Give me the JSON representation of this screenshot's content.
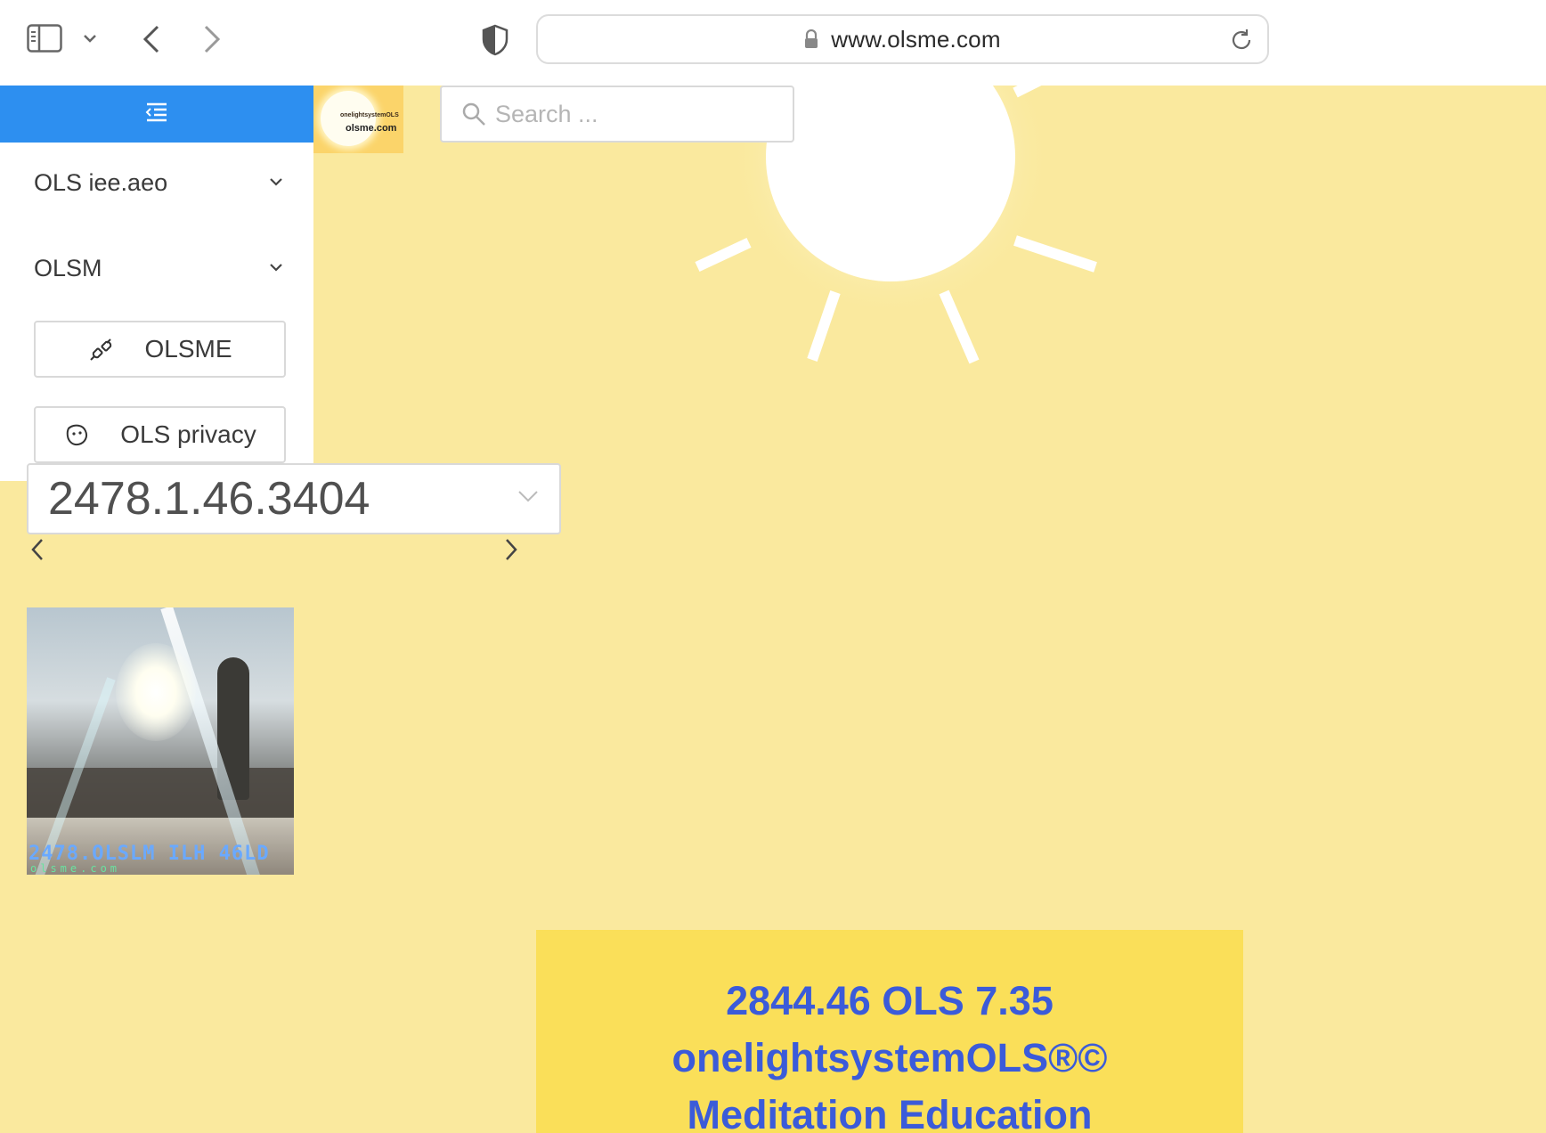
{
  "browser": {
    "url": "www.olsme.com"
  },
  "logo": {
    "line1": "onelightsystemOLS",
    "line2": "olsme.com"
  },
  "search": {
    "placeholder": "Search ..."
  },
  "side_menu": {
    "items": [
      {
        "label": "OLS iee.aeo"
      },
      {
        "label": "OLSM"
      }
    ],
    "buttons": [
      {
        "label": "OLSME",
        "icon": "plug-icon"
      },
      {
        "label": "OLS privacy",
        "icon": "smile-icon"
      }
    ]
  },
  "selector": {
    "value": "2478.1.46.3404"
  },
  "photo": {
    "caption": "2478.OLSLM ILH 46LD",
    "watermark": "olsme.com"
  },
  "banner": {
    "line1": "2844.46 OLS 7.35",
    "line2": "onelightsystemOLS®©",
    "line3": "Meditation Education"
  },
  "colors": {
    "page_bg": "#fae99e",
    "menu_bar": "#2d8ff0",
    "banner_bg": "#fadf59",
    "banner_text": "#3b5bd9"
  }
}
